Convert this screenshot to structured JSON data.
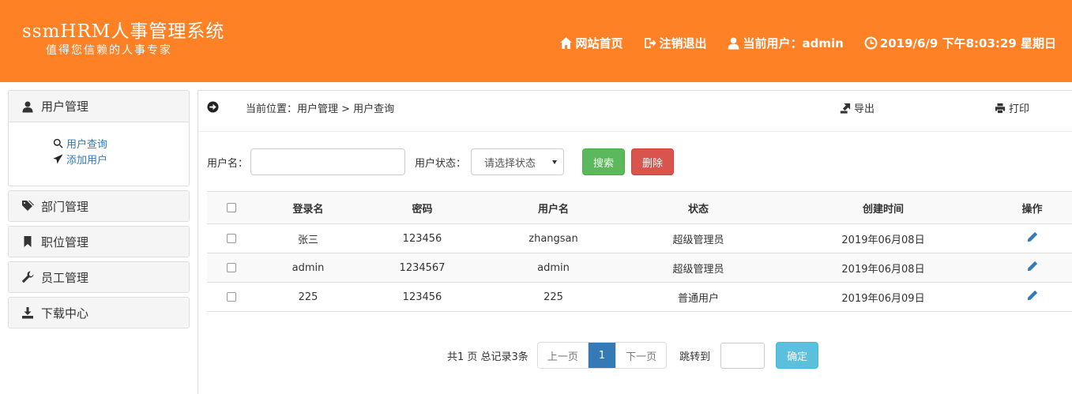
{
  "header": {
    "title": "ssmHRM人事管理系统",
    "subtitle": "值得您信赖的人事专家",
    "nav": {
      "home": "网站首页",
      "logout": "注销退出",
      "current_user": "当前用户：admin",
      "datetime": "2019/6/9 下午8:03:29 星期日"
    }
  },
  "sidebar": {
    "user_mgmt": {
      "label": "用户管理",
      "items": [
        "用户查询",
        "添加用户"
      ]
    },
    "dept_mgmt": "部门管理",
    "position_mgmt": "职位管理",
    "employee_mgmt": "员工管理",
    "download_center": "下载中心"
  },
  "breadcrumb": {
    "text": "当前位置：用户管理 > 用户查询",
    "export": "导出",
    "print": "打印"
  },
  "search": {
    "username_label": "用户名：",
    "username_value": "",
    "status_label": "用户状态：",
    "status_selected": "请选择状态",
    "search_button": "搜索",
    "delete_button": "删除"
  },
  "table": {
    "headers": [
      "登录名",
      "密码",
      "用户名",
      "状态",
      "创建时间",
      "操作"
    ],
    "rows": [
      [
        "张三",
        "123456",
        "zhangsan",
        "超级管理员",
        "2019年06月08日"
      ],
      [
        "admin",
        "1234567",
        "admin",
        "超级管理员",
        "2019年06月08日"
      ],
      [
        "225",
        "123456",
        "225",
        "普通用户",
        "2019年06月09日"
      ]
    ]
  },
  "pagination": {
    "total": "共1 页  总记录3条",
    "prev": "上一页",
    "current": "1",
    "next": "下一页",
    "jump_label": "跳转到",
    "confirm": "确定"
  }
}
